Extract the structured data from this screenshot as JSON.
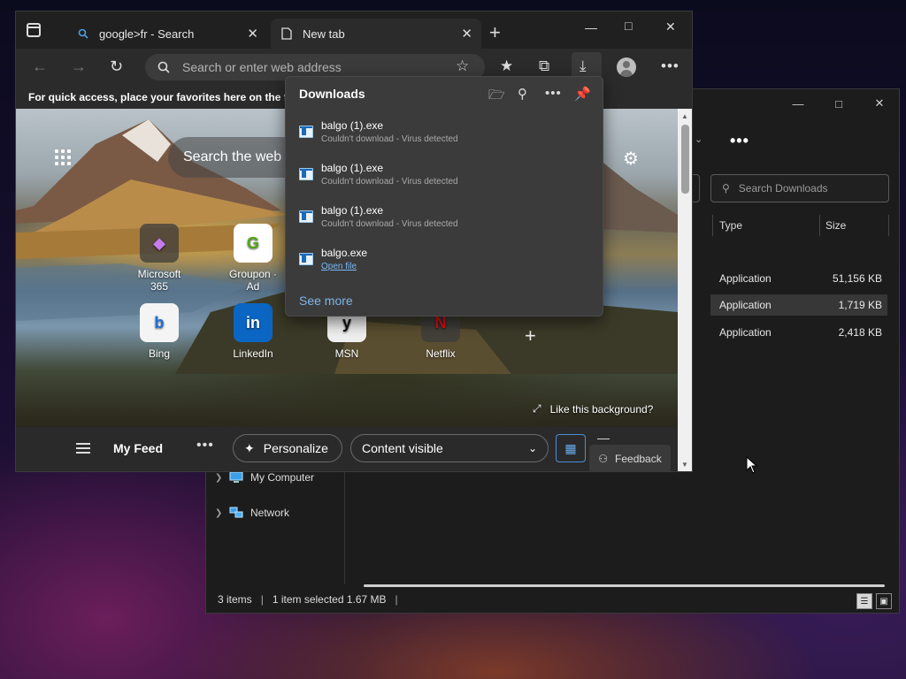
{
  "explorer": {
    "search_placeholder": "Search Downloads",
    "columns": {
      "type": "Type",
      "size": "Size"
    },
    "files": [
      {
        "type": "Application",
        "size": "51,156 KB"
      },
      {
        "type": "Application",
        "size": "1,719 KB"
      },
      {
        "type": "Application",
        "size": "2,418 KB"
      }
    ],
    "nav": {
      "my_computer": "My Computer",
      "network": "Network"
    },
    "status": {
      "items": "3 items",
      "selected": "1 item selected  1.67 MB"
    }
  },
  "edge": {
    "tabs": [
      {
        "label": "google>fr - Search"
      },
      {
        "label": "New tab"
      }
    ],
    "omnibox_placeholder": "Search or enter web address",
    "favorites_hint": "For quick access, place your favorites here on the favo",
    "ntp": {
      "search_placeholder": "Search the web",
      "tiles": [
        {
          "label": "Microsoft 365",
          "glyph": "◆"
        },
        {
          "label": "Groupon · Ad",
          "glyph": "G"
        },
        {
          "label": "Bing",
          "glyph": "b"
        },
        {
          "label": "LinkedIn",
          "glyph": "in"
        },
        {
          "label": "MSN",
          "glyph": "y"
        },
        {
          "label": "Netflix",
          "glyph": "N"
        }
      ],
      "like_background": "Like this background?"
    },
    "feed": {
      "title": "My Feed",
      "personalize": "Personalize",
      "content_visible": "Content visible",
      "feedback": "Feedback"
    }
  },
  "downloads": {
    "title": "Downloads",
    "items": [
      {
        "name": "balgo (1).exe",
        "status": "Couldn't download - Virus detected"
      },
      {
        "name": "balgo (1).exe",
        "status": "Couldn't download - Virus detected"
      },
      {
        "name": "balgo (1).exe",
        "status": "Couldn't download - Virus detected"
      },
      {
        "name": "balgo.exe",
        "link": "Open file"
      }
    ],
    "see_more": "See more"
  },
  "colors": {
    "accent_link": "#7fb5ea",
    "netflix_red": "#e50914",
    "linkedin_blue": "#0a66c2",
    "groupon_green": "#53a318"
  }
}
